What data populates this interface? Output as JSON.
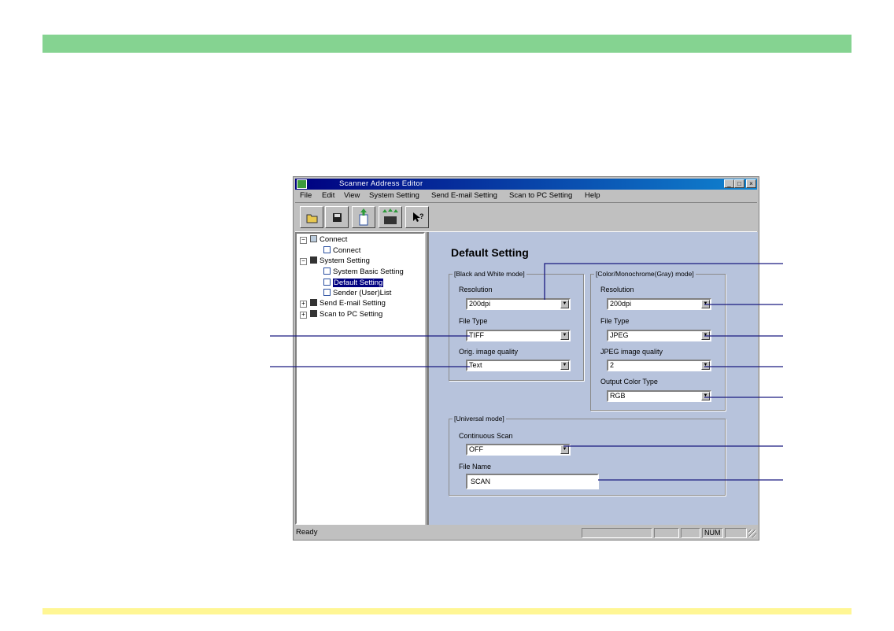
{
  "colors": {
    "top_bar": "#85d391",
    "bottom_bar": "#fff694",
    "callout_line": "#1a1a80"
  },
  "window": {
    "title": "Scanner Address Editor",
    "controls": {
      "minimize": "_",
      "maximize": "□",
      "close": "×"
    }
  },
  "menu": [
    "File",
    "Edit",
    "View",
    "System Setting",
    "Send E-mail Setting",
    "Scan to PC Setting",
    "Help"
  ],
  "toolbar": [
    "open-folder-icon",
    "save-disk-icon",
    "upload-document-icon",
    "transfer-scanner-icon",
    "help-pointer-icon"
  ],
  "tree": {
    "items": [
      {
        "label": "Connect",
        "expander": "−"
      },
      {
        "label": "Connect"
      },
      {
        "label": "System Setting",
        "expander": "−"
      },
      {
        "label": "System Basic Setting"
      },
      {
        "label": "Default Setting"
      },
      {
        "label": "Sender (User)List"
      },
      {
        "label": "Send E-mail Setting",
        "expander": "+"
      },
      {
        "label": "Scan to PC Setting",
        "expander": "+"
      }
    ]
  },
  "panel": {
    "title": "Default Setting",
    "bw": {
      "title": "[Black and White mode]",
      "resolution_label": "Resolution",
      "resolution_value": "200dpi",
      "filetype_label": "File Type",
      "filetype_value": "TIFF",
      "quality_label": "Orig. image quality",
      "quality_value": "Text"
    },
    "color": {
      "title": "[Color/Monochrome(Gray) mode]",
      "resolution_label": "Resolution",
      "resolution_value": "200dpi",
      "filetype_label": "File Type",
      "filetype_value": "JPEG",
      "jpeg_label": "JPEG image quality",
      "jpeg_value": "2",
      "output_label": "Output Color Type",
      "output_value": "RGB"
    },
    "universal": {
      "title": "[Universal mode]",
      "continuous_label": "Continuous Scan",
      "continuous_value": "OFF",
      "filename_label": "File Name",
      "filename_value": "SCAN"
    }
  },
  "status": {
    "text": "Ready",
    "num": "NUM"
  }
}
